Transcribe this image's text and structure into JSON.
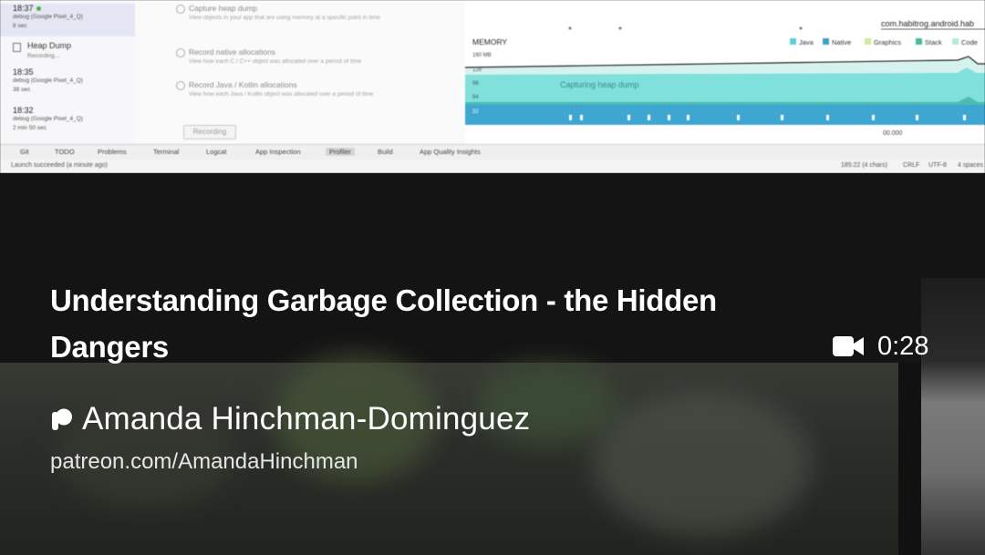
{
  "studio": {
    "sessions": [
      {
        "time": "18:37",
        "device": "debug (Google Pixel_4_Q)",
        "duration": "8 sec",
        "live": true
      },
      {
        "time": "18:35",
        "device": "debug (Google Pixel_4_Q)",
        "duration": "38 sec",
        "live": false
      },
      {
        "time": "18:32",
        "device": "debug (Google Pixel_4_Q)",
        "duration": "2 min 50 sec",
        "live": false
      }
    ],
    "heap_dump": {
      "label": "Heap Dump",
      "status": "Recording..."
    },
    "options": [
      {
        "label": "Capture heap dump",
        "desc": "View objects in your app that are using memory at a specific point in time"
      },
      {
        "label": "Record native allocations",
        "desc": "View how each C / C++ object was allocated over a period of time"
      },
      {
        "label": "Record Java / Kotlin allocations",
        "desc": "View how each Java / Kotlin object was allocated over a period of time"
      }
    ],
    "record_button": "Recording",
    "memory": {
      "process": "com.habitrog.android.hab",
      "title": "MEMORY",
      "y_ticks": [
        "160 MB",
        "128",
        "96",
        "64",
        "32"
      ],
      "legend": [
        "Java",
        "Native",
        "Graphics",
        "Stack",
        "Code"
      ],
      "overlay": "Capturing heap dump",
      "time_label": "00.000",
      "colors": {
        "java": "#5bd0d8",
        "native": "#3ea0c8",
        "graphics": "#d2e9a0",
        "stack": "#48b8a0",
        "code": "#b8e8e0"
      }
    },
    "tool_tabs": [
      "Git",
      "TODO",
      "Problems",
      "Terminal",
      "Logcat",
      "App Inspection",
      "Profiler",
      "Build",
      "App Quality Insights"
    ],
    "active_tab": "Profiler",
    "status_left": "Launch succeeded (a minute ago)",
    "status_right": [
      "185:22 (4 chars)",
      "CRLF",
      "UTF-8",
      "4 spaces"
    ]
  },
  "video": {
    "title": "Understanding Garbage Collection - the Hidden Dangers",
    "duration": "0:28",
    "icon": "video-camera-icon"
  },
  "creator": {
    "name": "Amanda Hinchman-Dominguez",
    "link": "patreon.com/AmandaHinchman",
    "icon": "patreon-icon"
  }
}
